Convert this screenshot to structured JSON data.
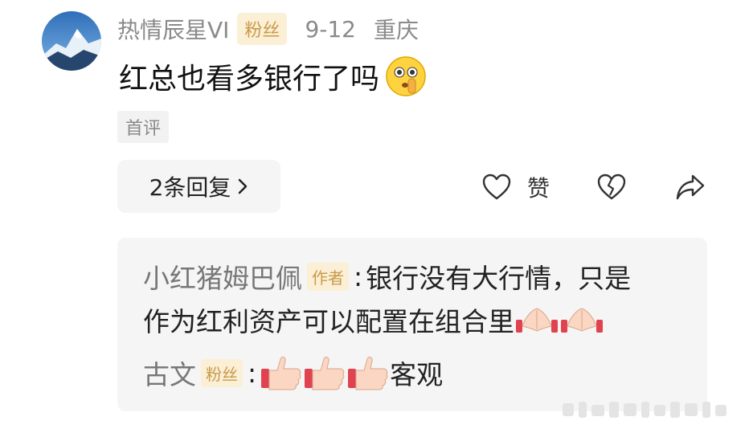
{
  "comment": {
    "avatar_icon": "snow-mountain-avatar",
    "username": "热情辰星VI",
    "fan_badge": "粉丝",
    "date": "9-12",
    "location": "重庆",
    "text": "红总也看多银行了吗",
    "text_emoji": "shushing-face-emoji",
    "first_tag": "首评"
  },
  "actions": {
    "replies_label": "2条回复",
    "replies_chevron": "›",
    "like_icon": "heart-icon",
    "like_label": "赞",
    "dislike_icon": "broken-heart-icon",
    "share_icon": "share-arrow-icon"
  },
  "replies": [
    {
      "author": "小红猪姆巴佩",
      "tag": "作者",
      "colon": ":",
      "text_line1": "银行没有大行情，只是",
      "text_line2": "作为红利资产可以配置在组合里",
      "emojis": [
        "clap-emoji",
        "clap-emoji"
      ]
    },
    {
      "author": "古文",
      "tag": "粉丝",
      "colon": ":",
      "emojis": [
        "thumbs-up-emoji",
        "thumbs-up-emoji",
        "thumbs-up-emoji"
      ],
      "text": "客观"
    }
  ],
  "colors": {
    "badge_bg": "#fbefd6",
    "badge_text": "#c99a4a",
    "muted_text": "#8a8a8a",
    "panel_bg": "#f5f5f5"
  }
}
